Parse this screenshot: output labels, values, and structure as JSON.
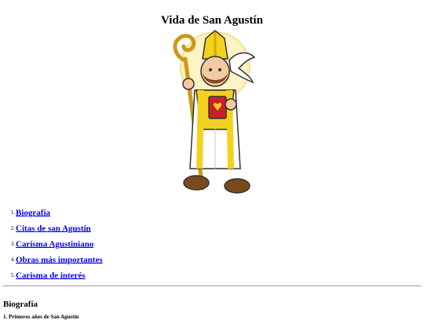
{
  "page": {
    "title": "Vida de San Agustín"
  },
  "hero": {
    "icon": "saint-augustine-illustration"
  },
  "toc": {
    "items": [
      {
        "number": "1.",
        "label": "Biografía"
      },
      {
        "number": "2.",
        "label": "Citas de san Agustín"
      },
      {
        "number": "3.",
        "label": "Carisma Agustiniano"
      },
      {
        "number": "4.",
        "label": "Obras más importantes"
      },
      {
        "number": "5.",
        "label": "Carisma de interés"
      }
    ]
  },
  "section": {
    "heading": "Biografía",
    "subheading": "1. Primeros años de San Agustín"
  },
  "colors": {
    "link": "#0000ee",
    "vestment_gold": "#f2d21e",
    "halo": "#fdf3c4"
  }
}
